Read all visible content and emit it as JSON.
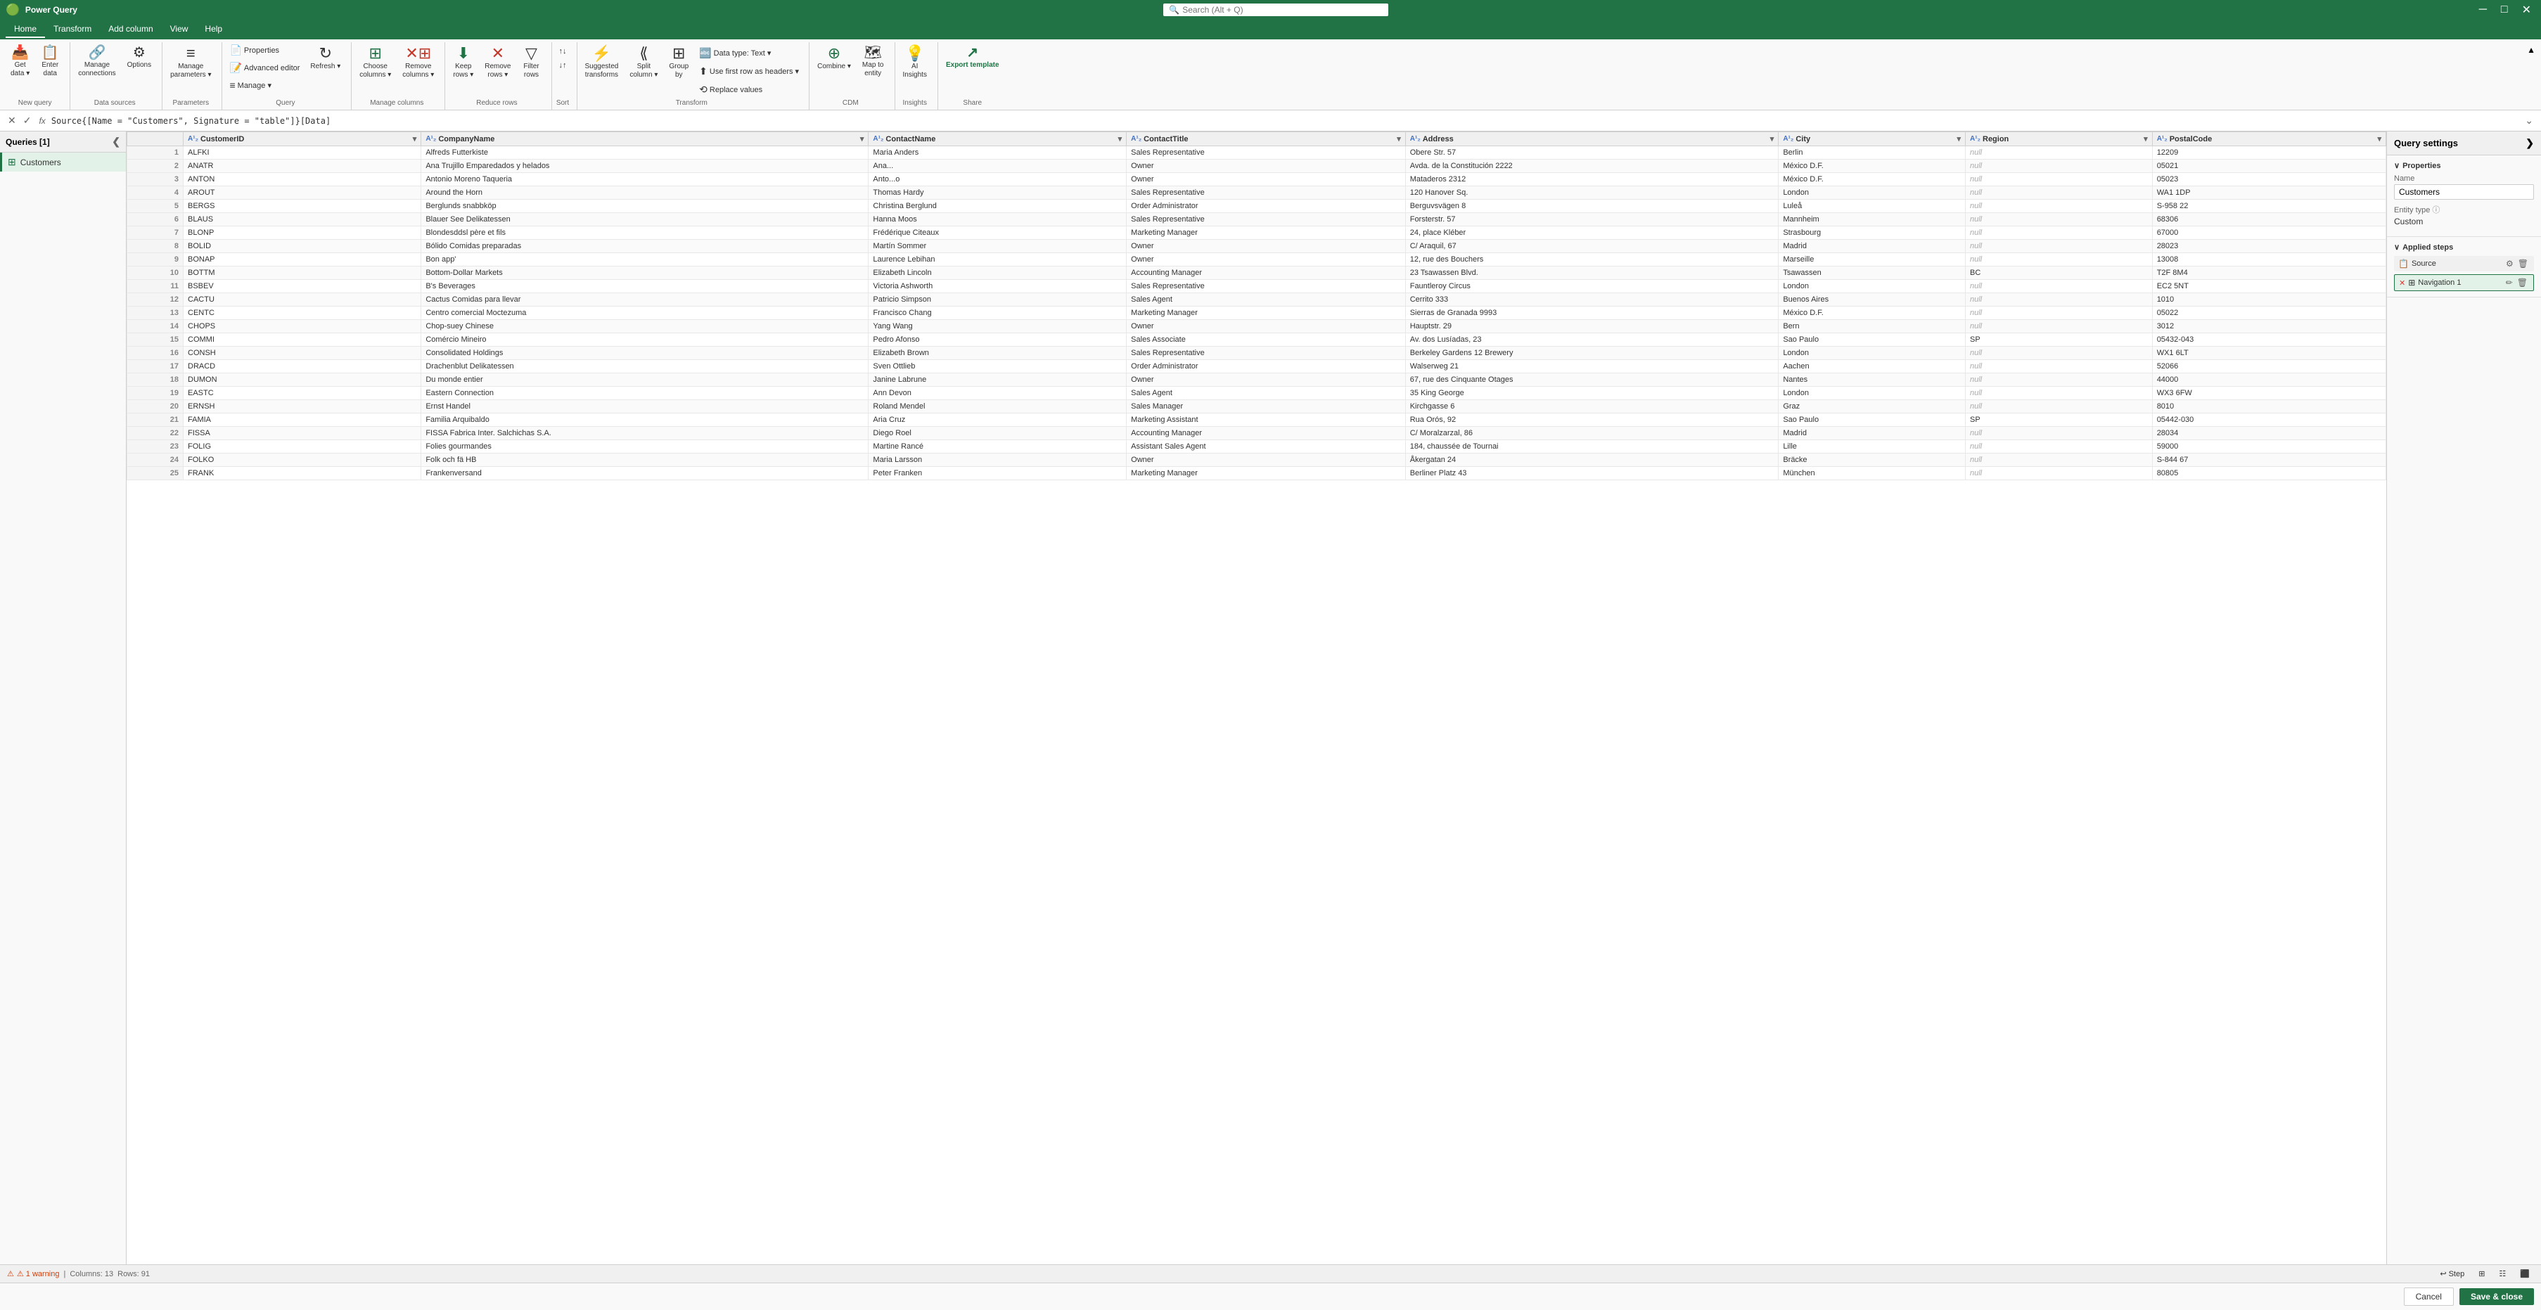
{
  "titleBar": {
    "title": "Power Query",
    "searchPlaceholder": "Search (Alt + Q)",
    "closeBtn": "✕",
    "minBtn": "─",
    "maxBtn": "□"
  },
  "tabs": [
    {
      "label": "Home",
      "active": true
    },
    {
      "label": "Transform",
      "active": false
    },
    {
      "label": "Add column",
      "active": false
    },
    {
      "label": "View",
      "active": false
    },
    {
      "label": "Help",
      "active": false
    }
  ],
  "ribbon": {
    "groups": [
      {
        "label": "New query",
        "buttons": [
          {
            "id": "get-data",
            "icon": "📥",
            "label": "Get\ndata ▾"
          },
          {
            "id": "enter-data",
            "icon": "📋",
            "label": "Enter\ndata"
          }
        ]
      },
      {
        "label": "Data sources",
        "buttons": [
          {
            "id": "manage-connections",
            "icon": "🔗",
            "label": "Manage\nconnections"
          },
          {
            "id": "options",
            "icon": "⚙",
            "label": "Options"
          }
        ]
      },
      {
        "label": "Parameters",
        "buttons": [
          {
            "id": "manage-parameters",
            "icon": "≡",
            "label": "Manage\nparameters ▾"
          }
        ]
      },
      {
        "label": "Query",
        "buttons": [
          {
            "id": "properties",
            "icon": "📄",
            "label": "Properties"
          },
          {
            "id": "advanced-editor",
            "icon": "📝",
            "label": "Advanced editor"
          },
          {
            "id": "manage",
            "icon": "≡",
            "label": "Manage ▾"
          },
          {
            "id": "refresh",
            "icon": "↻",
            "label": "Refresh ▾"
          }
        ]
      },
      {
        "label": "Manage columns",
        "buttons": [
          {
            "id": "choose-columns",
            "icon": "☷",
            "label": "Choose\ncolumns ▾"
          },
          {
            "id": "remove-columns",
            "icon": "✕☷",
            "label": "Remove\ncolumns ▾"
          }
        ]
      },
      {
        "label": "Reduce rows",
        "buttons": [
          {
            "id": "keep-rows",
            "icon": "⬇☷",
            "label": "Keep\nrows ▾"
          },
          {
            "id": "remove-rows",
            "icon": "✕☷",
            "label": "Remove\nrows ▾"
          },
          {
            "id": "filter-rows",
            "icon": "▽",
            "label": "Filter\nrows"
          }
        ]
      },
      {
        "label": "Sort",
        "buttons": [
          {
            "id": "sort-asc",
            "icon": "↑↓",
            "label": ""
          },
          {
            "id": "sort-desc",
            "icon": "↓↑",
            "label": ""
          }
        ]
      },
      {
        "label": "Transform",
        "buttons": [
          {
            "id": "suggested-transforms",
            "icon": "⚡",
            "label": "Suggested\ntransforms"
          },
          {
            "id": "split-column",
            "icon": "⟪⟫",
            "label": "Split\ncolumn ▾"
          },
          {
            "id": "group-by",
            "icon": "⊞",
            "label": "Group\nby"
          },
          {
            "id": "data-type",
            "icon": "🔤",
            "label": "Data type: Text ▾"
          },
          {
            "id": "use-first-row",
            "icon": "⬆☷",
            "label": "Use first row as headers ▾"
          },
          {
            "id": "replace-values",
            "icon": "⟲",
            "label": "Replace values"
          }
        ]
      },
      {
        "label": "CDM",
        "buttons": [
          {
            "id": "combine",
            "icon": "⊕",
            "label": "Combine ▾"
          },
          {
            "id": "map-to-entity",
            "icon": "🗺",
            "label": "Map to\nentity"
          }
        ]
      },
      {
        "label": "Insights",
        "buttons": [
          {
            "id": "ai-insights",
            "icon": "💡",
            "label": "AI\nInsights"
          }
        ]
      },
      {
        "label": "Share",
        "buttons": [
          {
            "id": "export-template",
            "icon": "↗",
            "label": "Export template"
          }
        ]
      }
    ]
  },
  "formulaBar": {
    "cancelBtn": "✕",
    "confirmBtn": "✓",
    "fxLabel": "fx",
    "formula": "Source{[Name = \"Customers\", Signature = \"table\"]}[Data]",
    "expandBtn": "⌄"
  },
  "queriesPanel": {
    "title": "Queries [1]",
    "collapseBtn": "❮",
    "items": [
      {
        "id": "customers",
        "icon": "⊞",
        "label": "Customers",
        "active": true
      }
    ]
  },
  "columns": [
    {
      "id": "customerid",
      "label": "CustomerID",
      "type": "ABC"
    },
    {
      "id": "companyname",
      "label": "CompanyName",
      "type": "ABC"
    },
    {
      "id": "contactname",
      "label": "ContactName",
      "type": "ABC"
    },
    {
      "id": "contacttitle",
      "label": "ContactTitle",
      "type": "ABC"
    },
    {
      "id": "address",
      "label": "Address",
      "type": "ABC"
    },
    {
      "id": "city",
      "label": "City",
      "type": "ABC"
    },
    {
      "id": "region",
      "label": "Region",
      "type": "ABC"
    },
    {
      "id": "postalcode",
      "label": "PostalCode",
      "type": "ABC"
    }
  ],
  "rows": [
    [
      1,
      "ALFKI",
      "Alfreds Futterkiste",
      "Maria Anders",
      "Sales Representative",
      "Obere Str. 57",
      "Berlin",
      "null",
      "12209"
    ],
    [
      2,
      "ANATR",
      "Ana Trujillo Emparedados y helados",
      "Ana...",
      "Owner",
      "Avda. de la Constitución 2222",
      "México D.F.",
      "null",
      "05021"
    ],
    [
      3,
      "ANTON",
      "Antonio Moreno Taqueria",
      "Anto...o",
      "Owner",
      "Mataderos 2312",
      "México D.F.",
      "null",
      "05023"
    ],
    [
      4,
      "AROUT",
      "Around the Horn",
      "Thomas Hardy",
      "Sales Representative",
      "120 Hanover Sq.",
      "London",
      "null",
      "WA1 1DP"
    ],
    [
      5,
      "BERGS",
      "Berglunds snabbköp",
      "Christina Berglund",
      "Order Administrator",
      "Berguvsvägen 8",
      "Luleå",
      "null",
      "S-958 22"
    ],
    [
      6,
      "BLAUS",
      "Blauer See Delikatessen",
      "Hanna Moos",
      "Sales Representative",
      "Forsterstr. 57",
      "Mannheim",
      "null",
      "68306"
    ],
    [
      7,
      "BLONP",
      "Blondesddsl père et fils",
      "Frédérique Citeaux",
      "Marketing Manager",
      "24, place Kléber",
      "Strasbourg",
      "null",
      "67000"
    ],
    [
      8,
      "BOLID",
      "Bólido Comidas preparadas",
      "Martín Sommer",
      "Owner",
      "C/ Araquil, 67",
      "Madrid",
      "null",
      "28023"
    ],
    [
      9,
      "BONAP",
      "Bon app'",
      "Laurence Lebihan",
      "Owner",
      "12, rue des Bouchers",
      "Marseille",
      "null",
      "13008"
    ],
    [
      10,
      "BOTTM",
      "Bottom-Dollar Markets",
      "Elizabeth Lincoln",
      "Accounting Manager",
      "23 Tsawassen Blvd.",
      "Tsawassen",
      "BC",
      "T2F 8M4"
    ],
    [
      11,
      "BSBEV",
      "B's Beverages",
      "Victoria Ashworth",
      "Sales Representative",
      "Fauntleroy Circus",
      "London",
      "null",
      "EC2 5NT"
    ],
    [
      12,
      "CACTU",
      "Cactus Comidas para llevar",
      "Patricio Simpson",
      "Sales Agent",
      "Cerrito 333",
      "Buenos Aires",
      "null",
      "1010"
    ],
    [
      13,
      "CENTC",
      "Centro comercial Moctezuma",
      "Francisco Chang",
      "Marketing Manager",
      "Sierras de Granada 9993",
      "México D.F.",
      "null",
      "05022"
    ],
    [
      14,
      "CHOPS",
      "Chop-suey Chinese",
      "Yang Wang",
      "Owner",
      "Hauptstr. 29",
      "Bern",
      "null",
      "3012"
    ],
    [
      15,
      "COMMI",
      "Comércio Mineiro",
      "Pedro Afonso",
      "Sales Associate",
      "Av. dos Lusíadas, 23",
      "Sao Paulo",
      "SP",
      "05432-043"
    ],
    [
      16,
      "CONSH",
      "Consolidated Holdings",
      "Elizabeth Brown",
      "Sales Representative",
      "Berkeley Gardens 12  Brewery",
      "London",
      "null",
      "WX1 6LT"
    ],
    [
      17,
      "DRACD",
      "Drachenblut Delikatessen",
      "Sven Ottlieb",
      "Order Administrator",
      "Walserweg 21",
      "Aachen",
      "null",
      "52066"
    ],
    [
      18,
      "DUMON",
      "Du monde entier",
      "Janine Labrune",
      "Owner",
      "67, rue des Cinquante Otages",
      "Nantes",
      "null",
      "44000"
    ],
    [
      19,
      "EASTC",
      "Eastern Connection",
      "Ann Devon",
      "Sales Agent",
      "35 King George",
      "London",
      "null",
      "WX3 6FW"
    ],
    [
      20,
      "ERNSH",
      "Ernst Handel",
      "Roland Mendel",
      "Sales Manager",
      "Kirchgasse 6",
      "Graz",
      "null",
      "8010"
    ],
    [
      21,
      "FAMIA",
      "Familia Arquibaldo",
      "Aria Cruz",
      "Marketing Assistant",
      "Rua Orós, 92",
      "Sao Paulo",
      "SP",
      "05442-030"
    ],
    [
      22,
      "FISSA",
      "FISSA Fabrica Inter. Salchichas S.A.",
      "Diego Roel",
      "Accounting Manager",
      "C/ Moralzarzal, 86",
      "Madrid",
      "null",
      "28034"
    ],
    [
      23,
      "FOLIG",
      "Folies gourmandes",
      "Martine Rancé",
      "Assistant Sales Agent",
      "184, chaussée de Tournai",
      "Lille",
      "null",
      "59000"
    ],
    [
      24,
      "FOLKO",
      "Folk och fä HB",
      "Maria Larsson",
      "Owner",
      "Åkergatan 24",
      "Bräcke",
      "null",
      "S-844 67"
    ],
    [
      25,
      "FRANK",
      "Frankenversand",
      "Peter Franken",
      "Marketing Manager",
      "Berliner Platz 43",
      "München",
      "null",
      "80805"
    ]
  ],
  "querySettings": {
    "title": "Query settings",
    "expandBtn": "❯",
    "propertiesSection": {
      "title": "Properties",
      "nameLabel": "Name",
      "nameValue": "Customers",
      "entityTypeLabel": "Entity type",
      "entityTypeValue": "Custom",
      "infoIcon": "ⓘ"
    },
    "appliedStepsSection": {
      "title": "Applied steps",
      "steps": [
        {
          "id": "source",
          "label": "Source",
          "icon": "📋",
          "active": false
        },
        {
          "id": "navigation",
          "label": "Navigation 1",
          "icon": "⊞",
          "active": true
        }
      ]
    }
  },
  "statusBar": {
    "warning": "⚠ 1 warning",
    "columns": "Columns: 13",
    "rows": "Rows: 91",
    "stepBtn": "Step",
    "btn2": "⊞",
    "btn3": "☷",
    "btn4": "⬛"
  },
  "bottomBar": {
    "cancelLabel": "Cancel",
    "saveLabel": "Save & close"
  }
}
